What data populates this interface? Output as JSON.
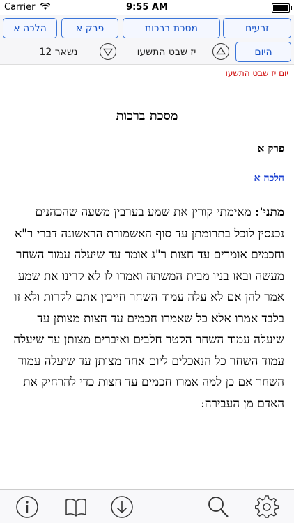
{
  "status_bar": {
    "carrier": "Carrier",
    "time": "9:55 AM"
  },
  "nav": {
    "row1": [
      "הלכה א",
      "פרק א",
      "מסכת ברכות",
      "זרעים"
    ],
    "today": "היום",
    "date": "יז שבט התשעו",
    "remaining": "נשאר 12"
  },
  "day_label": "יום יז שבט התשעו",
  "masechet_title": "מסכת ברכות",
  "perek_title": "פרק א",
  "halacha_title": "הלכה א",
  "text": {
    "lead": "מתני':",
    "body": " מאימתי קורין את שמע בערבין משעה שהכהנים נכנסין לוכל בתרומתן עד סוף האשמורת הראשונה דברי ר\"א וחכמים אומרים עד חצות ר\"ג אומר עד שיעלה עמוד השחר מעשה ובאו בניו מבית המשתה ואמרו לו לא קרינו את שמע אמר להן אם לא עלה עמוד השחר חייבין אתם לקרות ולא זו בלבד אמרו אלא כל שאמרו חכמים עד חצות מצותן עד שיעלה עמוד השחר הקטר חלבים ואיברים מצותן עד שיעלה עמוד השחר כל הנאכלים ליום אחד מצותן עד שיעלה עמוד השחר אם כן למה אמרו חכמים עד חצות כדי להרחיק את האדם מן העבירה:"
  },
  "toolbar": [
    "info-icon",
    "book-icon",
    "download-icon",
    "search-icon",
    "settings-gear-icon"
  ]
}
